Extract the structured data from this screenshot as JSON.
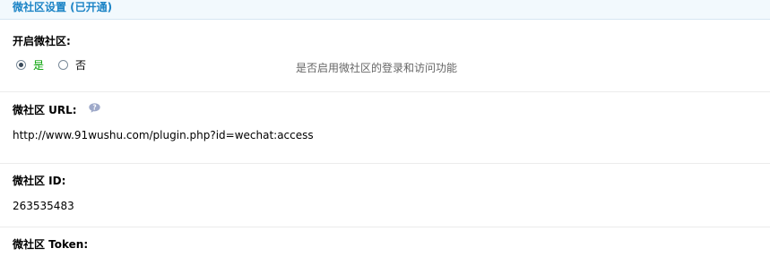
{
  "section": {
    "title": "微社区设置 (已开通)"
  },
  "enable": {
    "label": "开启微社区:",
    "options": [
      {
        "label": "是",
        "checked": true
      },
      {
        "label": "否",
        "checked": false
      }
    ],
    "hint": "是否启用微社区的登录和访问功能"
  },
  "url": {
    "label": "微社区 URL:",
    "help_icon": "help-bubble-icon",
    "value": "http://www.91wushu.com/plugin.php?id=wechat:access"
  },
  "id": {
    "label": "微社区 ID:",
    "value": "263535483"
  },
  "token": {
    "label": "微社区 Token:"
  },
  "colors": {
    "header_text": "#1c84c6",
    "header_bg": "#f2f9fd",
    "checked_text": "#00a000",
    "hint_text": "#666666"
  }
}
